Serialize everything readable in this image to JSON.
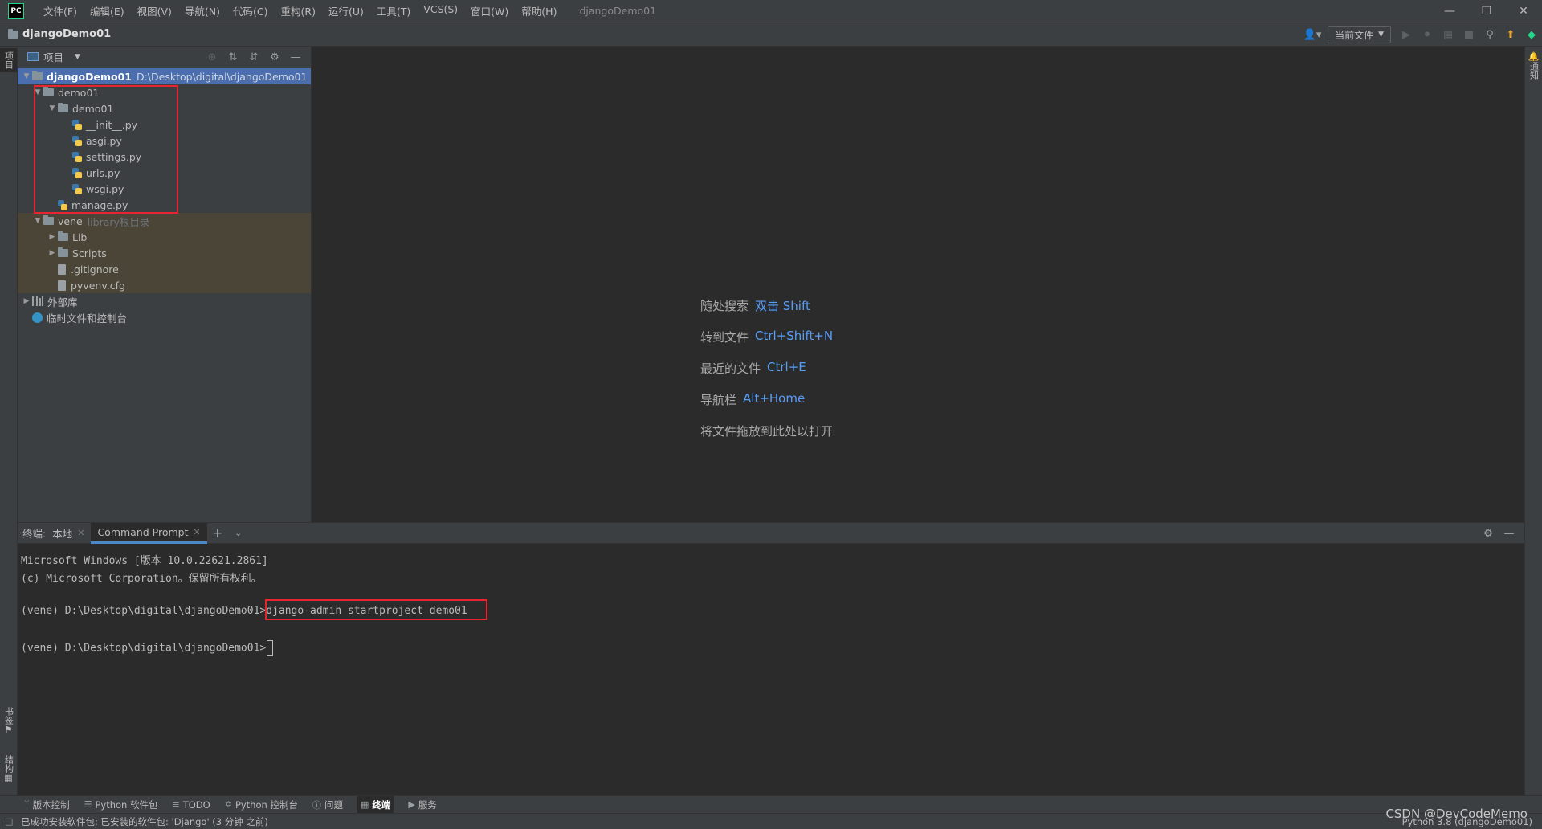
{
  "window": {
    "logo": "PC",
    "title": "djangoDemo01",
    "menu": [
      "文件(F)",
      "编辑(E)",
      "视图(V)",
      "导航(N)",
      "代码(C)",
      "重构(R)",
      "运行(U)",
      "工具(T)",
      "VCS(S)",
      "窗口(W)",
      "帮助(H)"
    ]
  },
  "navbar": {
    "project": "djangoDemo01",
    "run_config": "当前文件"
  },
  "stripes": {
    "project": "项目",
    "bookmarks": "书签",
    "structure": "结构",
    "notifications": "通知"
  },
  "project_panel": {
    "title": "项目",
    "tree": [
      {
        "label": "djangoDemo01",
        "extra": "D:\\Desktop\\digital\\djangoDemo01"
      },
      {
        "label": "demo01"
      },
      {
        "label": "demo01"
      },
      {
        "label": "__init__.py"
      },
      {
        "label": "asgi.py"
      },
      {
        "label": "settings.py"
      },
      {
        "label": "urls.py"
      },
      {
        "label": "wsgi.py"
      },
      {
        "label": "manage.py"
      },
      {
        "label": "vene",
        "extra": "library根目录"
      },
      {
        "label": "Lib"
      },
      {
        "label": "Scripts"
      },
      {
        "label": ".gitignore"
      },
      {
        "label": "pyvenv.cfg"
      },
      {
        "label": "外部库"
      },
      {
        "label": "临时文件和控制台"
      }
    ]
  },
  "editor_hints": [
    {
      "text": "随处搜索",
      "key": "双击 Shift"
    },
    {
      "text": "转到文件",
      "key": "Ctrl+Shift+N"
    },
    {
      "text": "最近的文件",
      "key": "Ctrl+E"
    },
    {
      "text": "导航栏",
      "key": "Alt+Home"
    },
    {
      "text": "将文件拖放到此处以打开",
      "key": ""
    }
  ],
  "terminal": {
    "label": "终端:",
    "tabs": [
      "本地",
      "Command Prompt"
    ],
    "lines": [
      "Microsoft Windows [版本 10.0.22621.2861]",
      "(c) Microsoft Corporation。保留所有权利。",
      "(vene) D:\\Desktop\\digital\\djangoDemo01>",
      "django-admin startproject demo01",
      "(vene) D:\\Desktop\\digital\\djangoDemo01>"
    ]
  },
  "bottom_tools": [
    "版本控制",
    "Python 软件包",
    "TODO",
    "Python 控制台",
    "问题",
    "终端",
    "服务"
  ],
  "status": {
    "message": "已成功安装软件包: 已安装的软件包: 'Django' (3 分钟 之前)",
    "interpreter": "Python 3.8 (djangoDemo01)"
  },
  "watermark": "CSDN @DevCodeMemo",
  "colors": {
    "accent": "#4a88c7",
    "highlight_box": "#e8242e",
    "shortcut": "#589df6"
  }
}
